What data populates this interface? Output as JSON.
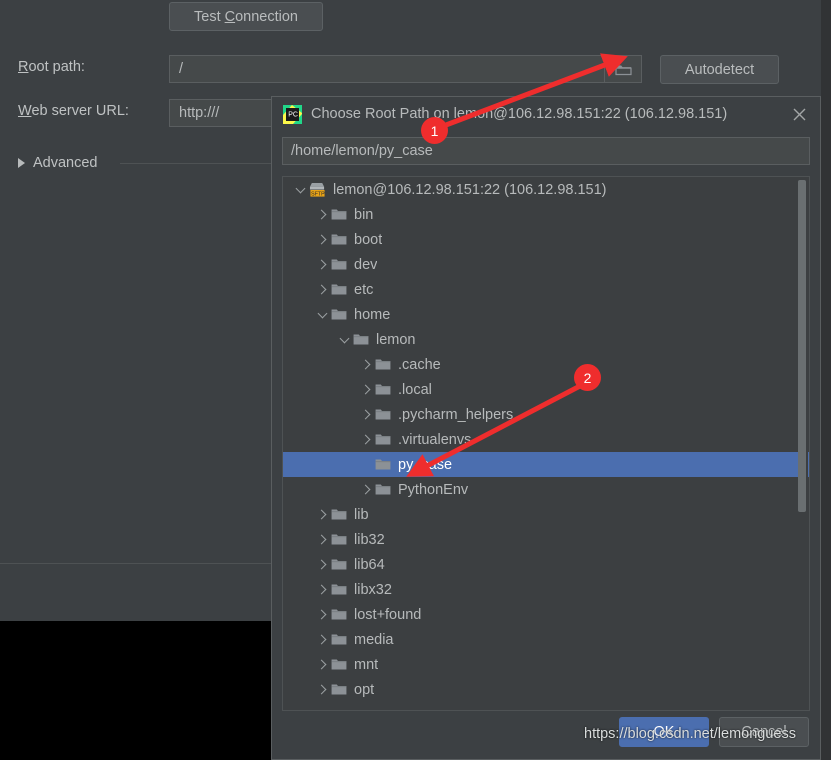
{
  "background_form": {
    "test_connection_button": "Test Connection",
    "test_connection_mnemonic": "C",
    "root_path_label": "Root path:",
    "root_path_mnemonic": "R",
    "root_path_value": "/",
    "web_server_url_label": "Web server URL:",
    "web_server_url_mnemonic": "W",
    "web_server_url_value": "http:///",
    "browse_icon": "folder-icon",
    "autodetect_button": "Autodetect",
    "advanced_label": "Advanced",
    "advanced_expanded": false
  },
  "dialog": {
    "icon": "pycharm-logo-icon",
    "title": "Choose Root Path on lemon@106.12.98.151:22 (106.12.98.151)",
    "close_icon": "close-icon",
    "path_input_value": "/home/lemon/py_case",
    "path_input_placeholder": "",
    "ok_button": "OK",
    "cancel_button": "Cancel",
    "tree": [
      {
        "label": "lemon@106.12.98.151:22 (106.12.98.151)",
        "depth": 0,
        "state": "expanded",
        "icon": "sftp-icon",
        "selected": false
      },
      {
        "label": "bin",
        "depth": 1,
        "state": "collapsed",
        "icon": "folder-icon",
        "selected": false
      },
      {
        "label": "boot",
        "depth": 1,
        "state": "collapsed",
        "icon": "folder-icon",
        "selected": false
      },
      {
        "label": "dev",
        "depth": 1,
        "state": "collapsed",
        "icon": "folder-icon",
        "selected": false
      },
      {
        "label": "etc",
        "depth": 1,
        "state": "collapsed",
        "icon": "folder-icon",
        "selected": false
      },
      {
        "label": "home",
        "depth": 1,
        "state": "expanded",
        "icon": "folder-icon",
        "selected": false
      },
      {
        "label": "lemon",
        "depth": 2,
        "state": "expanded",
        "icon": "folder-icon",
        "selected": false
      },
      {
        "label": ".cache",
        "depth": 3,
        "state": "collapsed",
        "icon": "folder-icon",
        "selected": false
      },
      {
        "label": ".local",
        "depth": 3,
        "state": "collapsed",
        "icon": "folder-icon",
        "selected": false
      },
      {
        "label": ".pycharm_helpers",
        "depth": 3,
        "state": "collapsed",
        "icon": "folder-icon",
        "selected": false
      },
      {
        "label": ".virtualenvs",
        "depth": 3,
        "state": "collapsed",
        "icon": "folder-icon",
        "selected": false
      },
      {
        "label": "py_case",
        "depth": 3,
        "state": "leaf",
        "icon": "folder-icon",
        "selected": true
      },
      {
        "label": "PythonEnv",
        "depth": 3,
        "state": "collapsed",
        "icon": "folder-icon",
        "selected": false
      },
      {
        "label": "lib",
        "depth": 1,
        "state": "collapsed",
        "icon": "folder-icon",
        "selected": false
      },
      {
        "label": "lib32",
        "depth": 1,
        "state": "collapsed",
        "icon": "folder-icon",
        "selected": false
      },
      {
        "label": "lib64",
        "depth": 1,
        "state": "collapsed",
        "icon": "folder-icon",
        "selected": false
      },
      {
        "label": "libx32",
        "depth": 1,
        "state": "collapsed",
        "icon": "folder-icon",
        "selected": false
      },
      {
        "label": "lost+found",
        "depth": 1,
        "state": "collapsed",
        "icon": "folder-icon",
        "selected": false
      },
      {
        "label": "media",
        "depth": 1,
        "state": "collapsed",
        "icon": "folder-icon",
        "selected": false
      },
      {
        "label": "mnt",
        "depth": 1,
        "state": "collapsed",
        "icon": "folder-icon",
        "selected": false
      },
      {
        "label": "opt",
        "depth": 1,
        "state": "collapsed",
        "icon": "folder-icon",
        "selected": false
      }
    ]
  },
  "annotations": {
    "badges": [
      {
        "number": "1"
      },
      {
        "number": "2"
      }
    ],
    "arrow_color": "#ef2d2d"
  },
  "watermark": "https://blog.csdn.net/lemonguess",
  "colors": {
    "window_background": "#3c4043",
    "tree_background": "#3c3f41",
    "selection_blue": "#4b6eaf",
    "text": "#b7babb",
    "annotation_red": "#ef2d2d",
    "folder_icon": "#8c9196"
  }
}
